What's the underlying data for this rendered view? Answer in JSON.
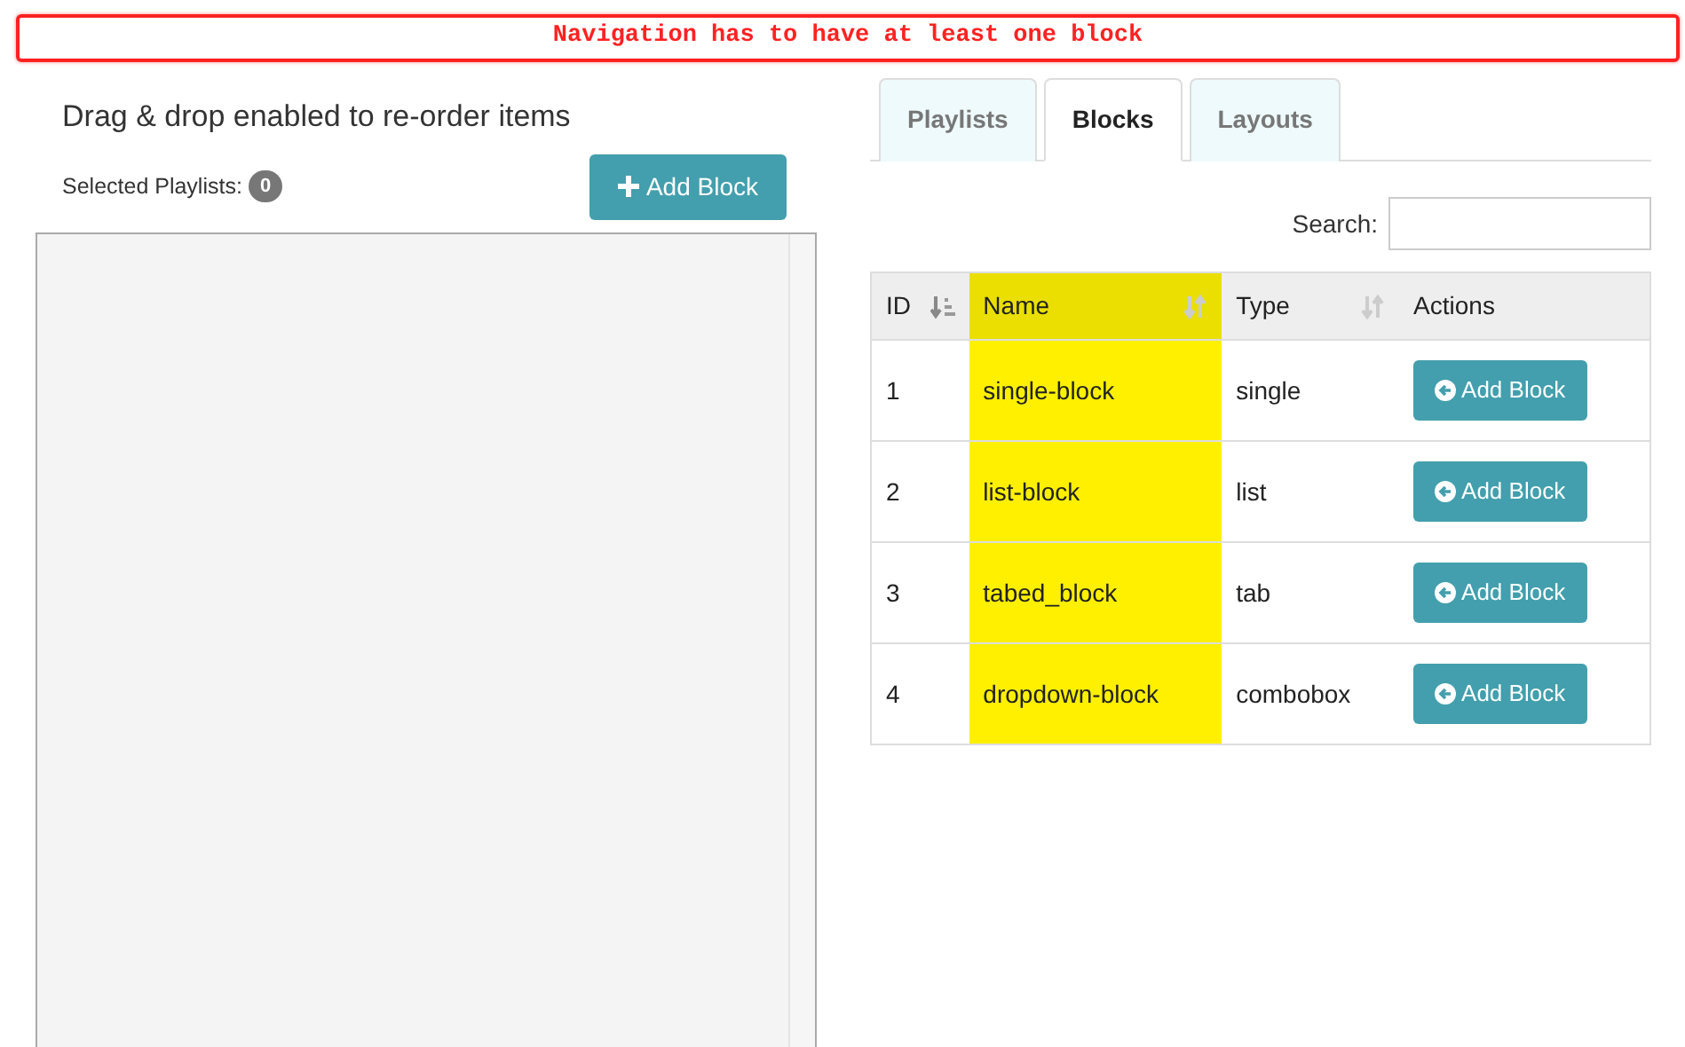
{
  "alert": {
    "message": "Navigation has to have at least one block"
  },
  "left_panel": {
    "heading": "Drag & drop enabled to re-order items",
    "selected_label": "Selected Playlists:",
    "selected_count": "0",
    "add_button": "Add Block"
  },
  "tabs": [
    {
      "label": "Playlists",
      "selected": false
    },
    {
      "label": "Blocks",
      "selected": true
    },
    {
      "label": "Layouts",
      "selected": false
    }
  ],
  "search": {
    "label": "Search:"
  },
  "table": {
    "columns": [
      {
        "label": "ID",
        "sortable": true,
        "sorted": true,
        "highlighted": false
      },
      {
        "label": "Name",
        "sortable": true,
        "sorted": false,
        "highlighted": true
      },
      {
        "label": "Type",
        "sortable": true,
        "sorted": false,
        "highlighted": false
      },
      {
        "label": "Actions",
        "highlighted": false
      }
    ],
    "rows": [
      {
        "cells": [
          "1",
          "single-block",
          "single"
        ],
        "action": "Add Block"
      },
      {
        "cells": [
          "2",
          "list-block",
          "list"
        ],
        "action": "Add Block"
      },
      {
        "cells": [
          "3",
          "tabed_block",
          "tab"
        ],
        "action": "Add Block"
      },
      {
        "cells": [
          "4",
          "dropdown-block",
          "combobox"
        ],
        "action": "Add Block"
      }
    ]
  }
}
